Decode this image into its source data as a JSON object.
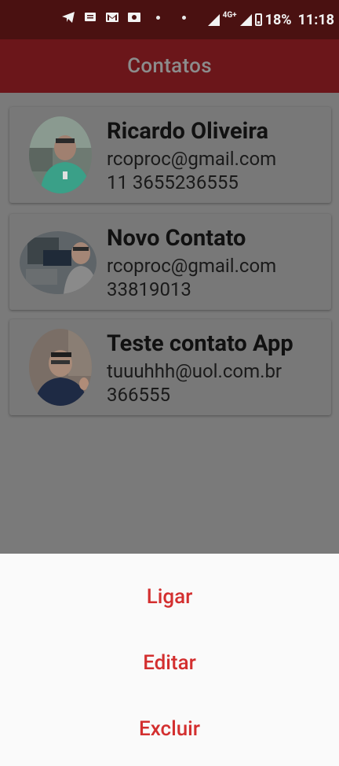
{
  "status_bar": {
    "network": "4G+",
    "battery": "18%",
    "time": "11:18",
    "icons": [
      "telegram-icon",
      "message-icon",
      "gmail-icon",
      "photo-icon",
      "dot-icon",
      "dot-icon",
      "signal-icon",
      "signal-icon",
      "battery-icon"
    ]
  },
  "appbar": {
    "title": "Contatos"
  },
  "contacts": [
    {
      "name": "Ricardo Oliveira",
      "email": "rcoproc@gmail.com",
      "phone": "11 3655236555"
    },
    {
      "name": "Novo Contato",
      "email": "rcoproc@gmail.com",
      "phone": "33819013"
    },
    {
      "name": "Teste contato App",
      "email": "tuuuhhh@uol.com.br",
      "phone": "366555"
    }
  ],
  "sheet": {
    "call_label": "Ligar",
    "edit_label": "Editar",
    "delete_label": "Excluir",
    "accent_color": "#d32f2f"
  },
  "colors": {
    "appbar": "#6b161a",
    "statusbar": "#4a1111",
    "overlay_bg": "#7a7a7a"
  }
}
